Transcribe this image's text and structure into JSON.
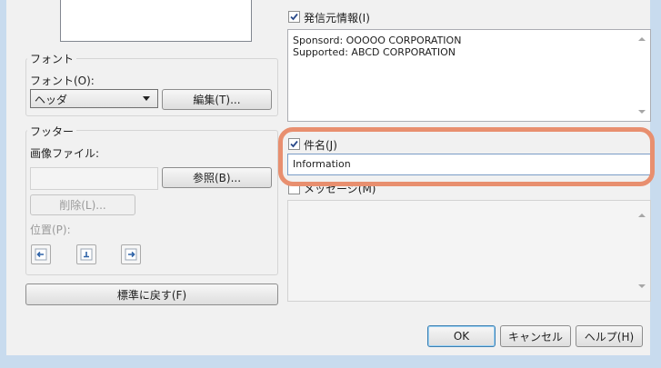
{
  "font_group": {
    "legend": "フォント",
    "font_label": "フォント(O):",
    "font_value": "ヘッダ",
    "edit_button": "編集(T)..."
  },
  "footer_group": {
    "legend": "フッター",
    "image_label": "画像ファイル:",
    "image_value": "",
    "browse_button": "参照(B)...",
    "delete_button": "削除(L)...",
    "position_label": "位置(P):"
  },
  "reset_button": "標準に戻す(F)",
  "sender_info": {
    "label": "発信元情報(I)",
    "checked": true,
    "lines": "Sponsord: OOOOO CORPORATION\nSupported: ABCD CORPORATION"
  },
  "subject": {
    "label": "件名(J)",
    "checked": true,
    "value": "Information"
  },
  "message": {
    "label": "メッセージ(M)",
    "checked": false
  },
  "dialog_buttons": {
    "ok": "OK",
    "cancel": "キャンセル",
    "help": "ヘルプ(H)"
  },
  "colors": {
    "highlight": "#e88f6f",
    "frame": "#c8dbee",
    "dialog_bg": "#f1f1f1"
  }
}
